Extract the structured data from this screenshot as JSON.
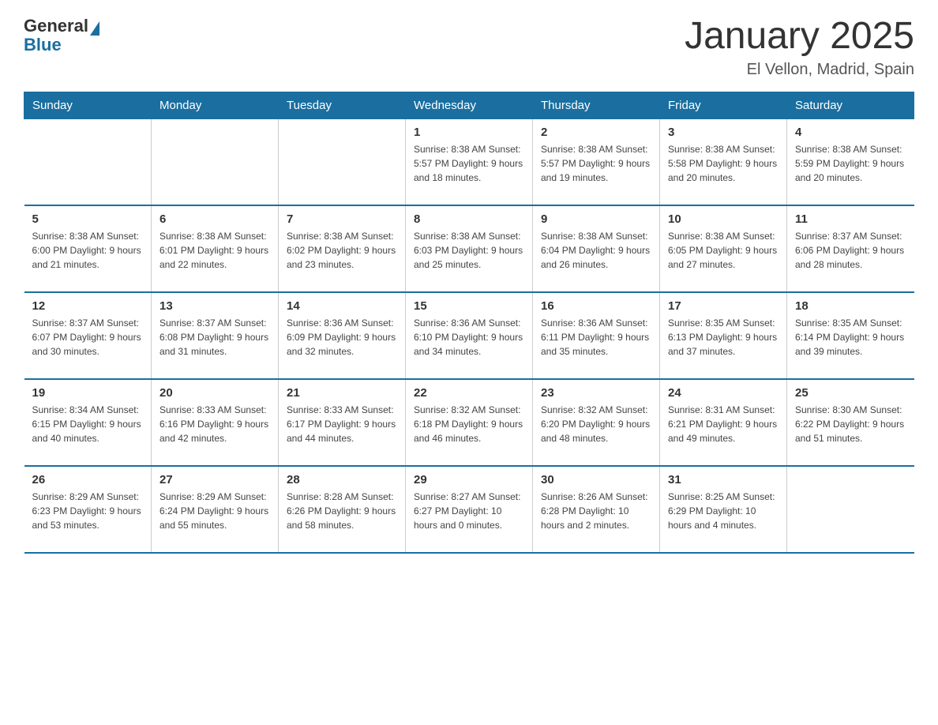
{
  "header": {
    "logo_general": "General",
    "logo_blue": "Blue",
    "month_title": "January 2025",
    "location": "El Vellon, Madrid, Spain"
  },
  "days_of_week": [
    "Sunday",
    "Monday",
    "Tuesday",
    "Wednesday",
    "Thursday",
    "Friday",
    "Saturday"
  ],
  "weeks": [
    [
      {
        "day": "",
        "info": ""
      },
      {
        "day": "",
        "info": ""
      },
      {
        "day": "",
        "info": ""
      },
      {
        "day": "1",
        "info": "Sunrise: 8:38 AM\nSunset: 5:57 PM\nDaylight: 9 hours\nand 18 minutes."
      },
      {
        "day": "2",
        "info": "Sunrise: 8:38 AM\nSunset: 5:57 PM\nDaylight: 9 hours\nand 19 minutes."
      },
      {
        "day": "3",
        "info": "Sunrise: 8:38 AM\nSunset: 5:58 PM\nDaylight: 9 hours\nand 20 minutes."
      },
      {
        "day": "4",
        "info": "Sunrise: 8:38 AM\nSunset: 5:59 PM\nDaylight: 9 hours\nand 20 minutes."
      }
    ],
    [
      {
        "day": "5",
        "info": "Sunrise: 8:38 AM\nSunset: 6:00 PM\nDaylight: 9 hours\nand 21 minutes."
      },
      {
        "day": "6",
        "info": "Sunrise: 8:38 AM\nSunset: 6:01 PM\nDaylight: 9 hours\nand 22 minutes."
      },
      {
        "day": "7",
        "info": "Sunrise: 8:38 AM\nSunset: 6:02 PM\nDaylight: 9 hours\nand 23 minutes."
      },
      {
        "day": "8",
        "info": "Sunrise: 8:38 AM\nSunset: 6:03 PM\nDaylight: 9 hours\nand 25 minutes."
      },
      {
        "day": "9",
        "info": "Sunrise: 8:38 AM\nSunset: 6:04 PM\nDaylight: 9 hours\nand 26 minutes."
      },
      {
        "day": "10",
        "info": "Sunrise: 8:38 AM\nSunset: 6:05 PM\nDaylight: 9 hours\nand 27 minutes."
      },
      {
        "day": "11",
        "info": "Sunrise: 8:37 AM\nSunset: 6:06 PM\nDaylight: 9 hours\nand 28 minutes."
      }
    ],
    [
      {
        "day": "12",
        "info": "Sunrise: 8:37 AM\nSunset: 6:07 PM\nDaylight: 9 hours\nand 30 minutes."
      },
      {
        "day": "13",
        "info": "Sunrise: 8:37 AM\nSunset: 6:08 PM\nDaylight: 9 hours\nand 31 minutes."
      },
      {
        "day": "14",
        "info": "Sunrise: 8:36 AM\nSunset: 6:09 PM\nDaylight: 9 hours\nand 32 minutes."
      },
      {
        "day": "15",
        "info": "Sunrise: 8:36 AM\nSunset: 6:10 PM\nDaylight: 9 hours\nand 34 minutes."
      },
      {
        "day": "16",
        "info": "Sunrise: 8:36 AM\nSunset: 6:11 PM\nDaylight: 9 hours\nand 35 minutes."
      },
      {
        "day": "17",
        "info": "Sunrise: 8:35 AM\nSunset: 6:13 PM\nDaylight: 9 hours\nand 37 minutes."
      },
      {
        "day": "18",
        "info": "Sunrise: 8:35 AM\nSunset: 6:14 PM\nDaylight: 9 hours\nand 39 minutes."
      }
    ],
    [
      {
        "day": "19",
        "info": "Sunrise: 8:34 AM\nSunset: 6:15 PM\nDaylight: 9 hours\nand 40 minutes."
      },
      {
        "day": "20",
        "info": "Sunrise: 8:33 AM\nSunset: 6:16 PM\nDaylight: 9 hours\nand 42 minutes."
      },
      {
        "day": "21",
        "info": "Sunrise: 8:33 AM\nSunset: 6:17 PM\nDaylight: 9 hours\nand 44 minutes."
      },
      {
        "day": "22",
        "info": "Sunrise: 8:32 AM\nSunset: 6:18 PM\nDaylight: 9 hours\nand 46 minutes."
      },
      {
        "day": "23",
        "info": "Sunrise: 8:32 AM\nSunset: 6:20 PM\nDaylight: 9 hours\nand 48 minutes."
      },
      {
        "day": "24",
        "info": "Sunrise: 8:31 AM\nSunset: 6:21 PM\nDaylight: 9 hours\nand 49 minutes."
      },
      {
        "day": "25",
        "info": "Sunrise: 8:30 AM\nSunset: 6:22 PM\nDaylight: 9 hours\nand 51 minutes."
      }
    ],
    [
      {
        "day": "26",
        "info": "Sunrise: 8:29 AM\nSunset: 6:23 PM\nDaylight: 9 hours\nand 53 minutes."
      },
      {
        "day": "27",
        "info": "Sunrise: 8:29 AM\nSunset: 6:24 PM\nDaylight: 9 hours\nand 55 minutes."
      },
      {
        "day": "28",
        "info": "Sunrise: 8:28 AM\nSunset: 6:26 PM\nDaylight: 9 hours\nand 58 minutes."
      },
      {
        "day": "29",
        "info": "Sunrise: 8:27 AM\nSunset: 6:27 PM\nDaylight: 10 hours\nand 0 minutes."
      },
      {
        "day": "30",
        "info": "Sunrise: 8:26 AM\nSunset: 6:28 PM\nDaylight: 10 hours\nand 2 minutes."
      },
      {
        "day": "31",
        "info": "Sunrise: 8:25 AM\nSunset: 6:29 PM\nDaylight: 10 hours\nand 4 minutes."
      },
      {
        "day": "",
        "info": ""
      }
    ]
  ]
}
